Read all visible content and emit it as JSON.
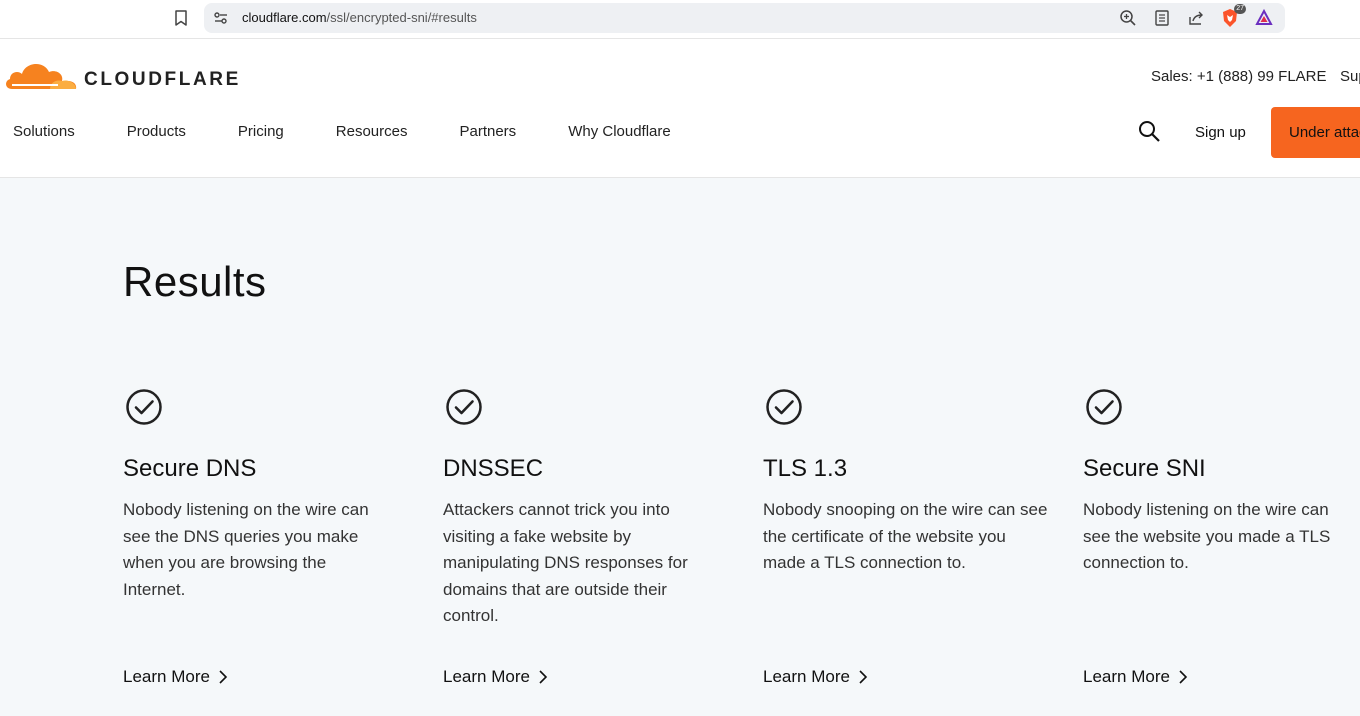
{
  "browser": {
    "url_host": "cloudflare.com",
    "url_path": "/ssl/encrypted-sni/#results",
    "brave_badge": "27"
  },
  "header": {
    "logo_text": "CLOUDFLARE",
    "sales": "Sales: +1 (888) 99 FLARE",
    "support": "Sup",
    "nav": [
      "Solutions",
      "Products",
      "Pricing",
      "Resources",
      "Partners",
      "Why Cloudflare"
    ],
    "signup": "Sign up",
    "attack_button": "Under attack?",
    "brand_color": "#f6821f"
  },
  "main": {
    "title": "Results",
    "cards": [
      {
        "title": "Secure DNS",
        "desc": "Nobody listening on the wire can see the DNS queries you make when you are browsing the Internet.",
        "link": "Learn More"
      },
      {
        "title": "DNSSEC",
        "desc": "Attackers cannot trick you into visiting a fake website by manipulating DNS responses for domains that are outside their control.",
        "link": "Learn More"
      },
      {
        "title": "TLS 1.3",
        "desc": "Nobody snooping on the wire can see the certificate of the website you made a TLS connection to.",
        "link": "Learn More"
      },
      {
        "title": "Secure SNI",
        "desc": "Nobody listening on the wire can see the website you made a TLS connection to.",
        "link": "Learn More"
      }
    ]
  }
}
